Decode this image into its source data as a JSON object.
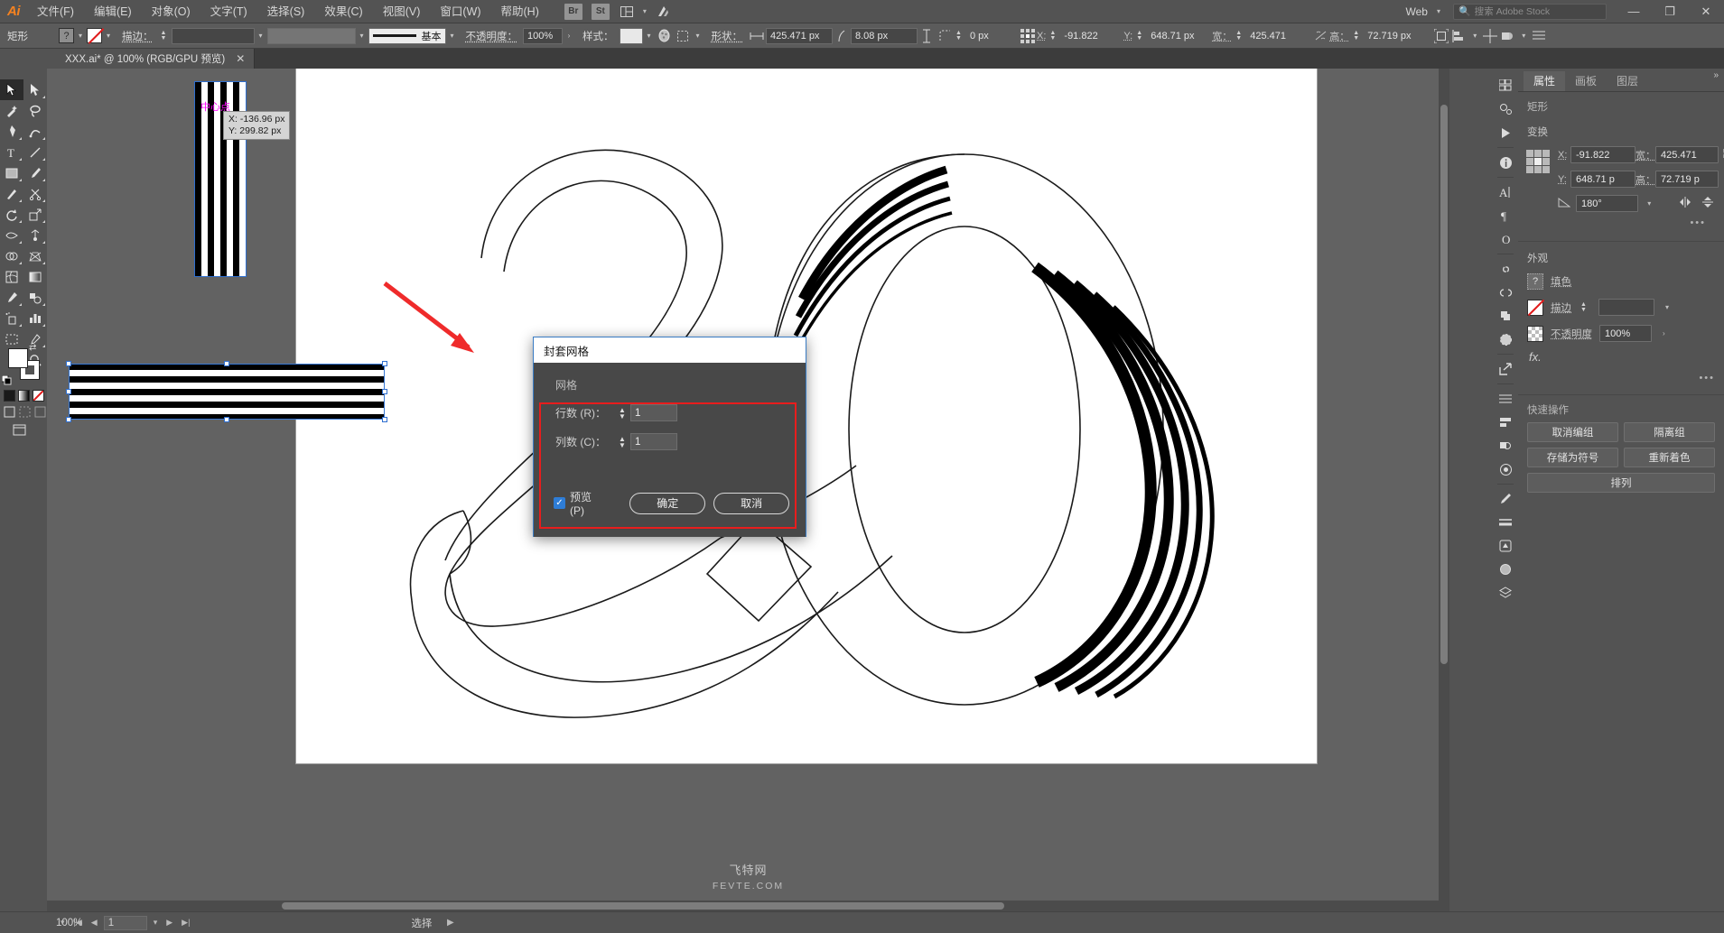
{
  "app": {
    "logo": "Ai",
    "menus": [
      "文件(F)",
      "编辑(E)",
      "对象(O)",
      "文字(T)",
      "选择(S)",
      "效果(C)",
      "视图(V)",
      "窗口(W)",
      "帮助(H)"
    ],
    "quick_buttons": [
      "Br",
      "St"
    ],
    "arrange_icon": "arrange-icon",
    "libraries_icon": "libraries-icon",
    "workspace": "Web",
    "search_placeholder": "搜索 Adobe Stock",
    "window_controls": {
      "minimize": "—",
      "maximize": "❐",
      "close": "✕"
    }
  },
  "control_bar": {
    "object_type": "矩形",
    "fill_label": "?",
    "stroke_label": "描边：",
    "stroke_weight": "",
    "brush_preset": "基本",
    "opacity_label": "不透明度：",
    "opacity_value": "100%",
    "style_label": "样式：",
    "shape_label": "形状：",
    "shape_width": "425.471 px",
    "corner_radius": "8.08 px",
    "extra_value": "0 px",
    "x_label": "X:",
    "x_value": "-91.822",
    "y_label": "Y:",
    "y_value": "648.71 px",
    "w_label": "宽：",
    "w_value": "425.471",
    "h_label": "高：",
    "h_value": "72.719 px"
  },
  "document_tab": {
    "title": "XXX.ai* @ 100% (RGB/GPU 预览)",
    "close": "✕"
  },
  "canvas": {
    "center_label": "中心点",
    "tooltip_x": "X: -136.96 px",
    "tooltip_y": "Y: 299.82 px",
    "watermark": "飞特网",
    "watermark_sub": "FEVTE.COM"
  },
  "dialog": {
    "title": "封套网格",
    "group_label": "网格",
    "rows_label": "行数 (R)：",
    "rows_value": "1",
    "cols_label": "列数 (C)：",
    "cols_value": "1",
    "preview_label": "预览 (P)",
    "preview_checked": true,
    "ok_label": "确定",
    "cancel_label": "取消",
    "highlight_color": "#e81d1d"
  },
  "properties": {
    "tabs": [
      "属性",
      "画板",
      "图层"
    ],
    "active_tab": "属性",
    "object_label": "矩形",
    "transform": {
      "title": "变换",
      "x_label": "X:",
      "x_value": "-91.822",
      "y_label": "Y:",
      "y_value": "648.71 p",
      "w_label": "宽：",
      "w_value": "425.471",
      "h_label": "高：",
      "h_value": "72.719 p",
      "angle_label": "∠:",
      "angle_value": "180°",
      "link_icon": "link-icon",
      "flip_h_icon": "flip-horizontal-icon",
      "flip_v_icon": "flip-vertical-icon",
      "more_options": "•••"
    },
    "appearance": {
      "title": "外观",
      "fill_label": "填色",
      "stroke_label": "描边",
      "stroke_weight": "",
      "opacity_label": "不透明度",
      "opacity_value": "100%",
      "fx_label": "fx.",
      "more_options": "•••"
    },
    "quick_actions": {
      "title": "快速操作",
      "buttons": [
        "取消编组",
        "隔离组",
        "存储为符号",
        "重新着色",
        "排列"
      ]
    }
  },
  "status_bar": {
    "zoom": "100%",
    "page": "1",
    "status_text": "选择"
  },
  "colors": {
    "chrome": "#535353",
    "panel": "#484848",
    "accent_blue": "#2e7dd7",
    "selection_blue": "#3778d6",
    "highlight_red": "#e81d1d",
    "magenta": "#ff00ff",
    "ai_orange": "#f58220"
  }
}
